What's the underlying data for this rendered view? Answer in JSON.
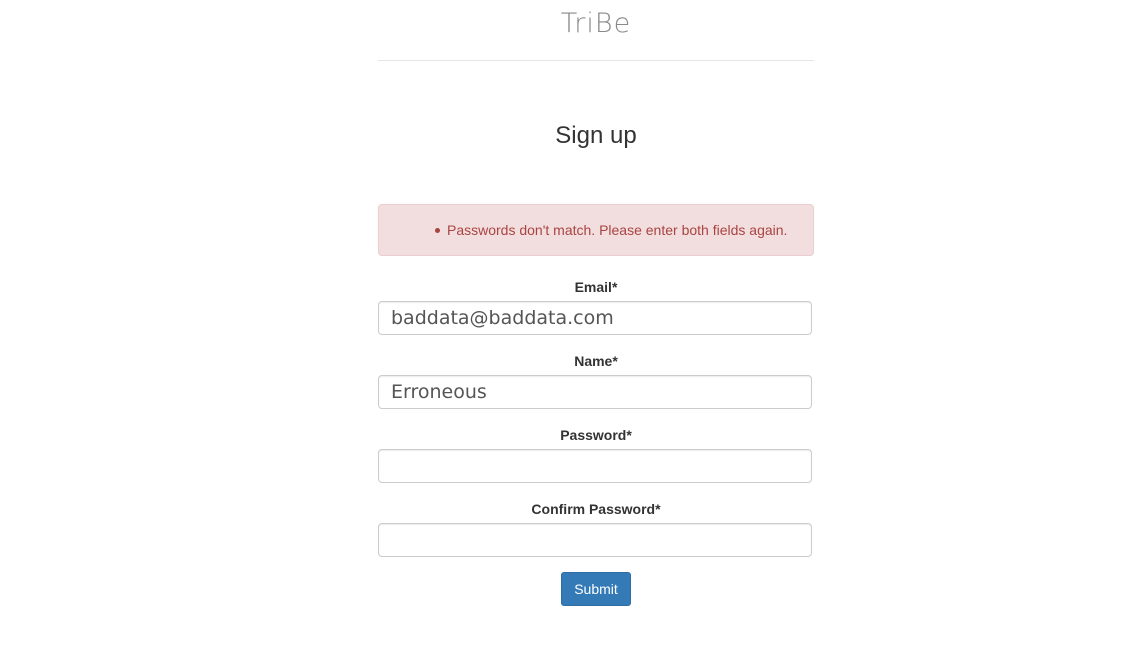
{
  "header": {
    "logo_text": "TriBe"
  },
  "page": {
    "title": "Sign up"
  },
  "alert": {
    "messages": [
      "Passwords don't match. Please enter both fields again."
    ],
    "color": "#a94442",
    "background": "#f2dede"
  },
  "form": {
    "email": {
      "label": "Email*",
      "value": "baddata@baddata.com"
    },
    "name": {
      "label": "Name*",
      "value": "Erroneous"
    },
    "password": {
      "label": "Password*",
      "value": ""
    },
    "confirm_password": {
      "label": "Confirm Password*",
      "value": ""
    },
    "submit_label": "Submit",
    "submit_color": "#337ab7"
  }
}
